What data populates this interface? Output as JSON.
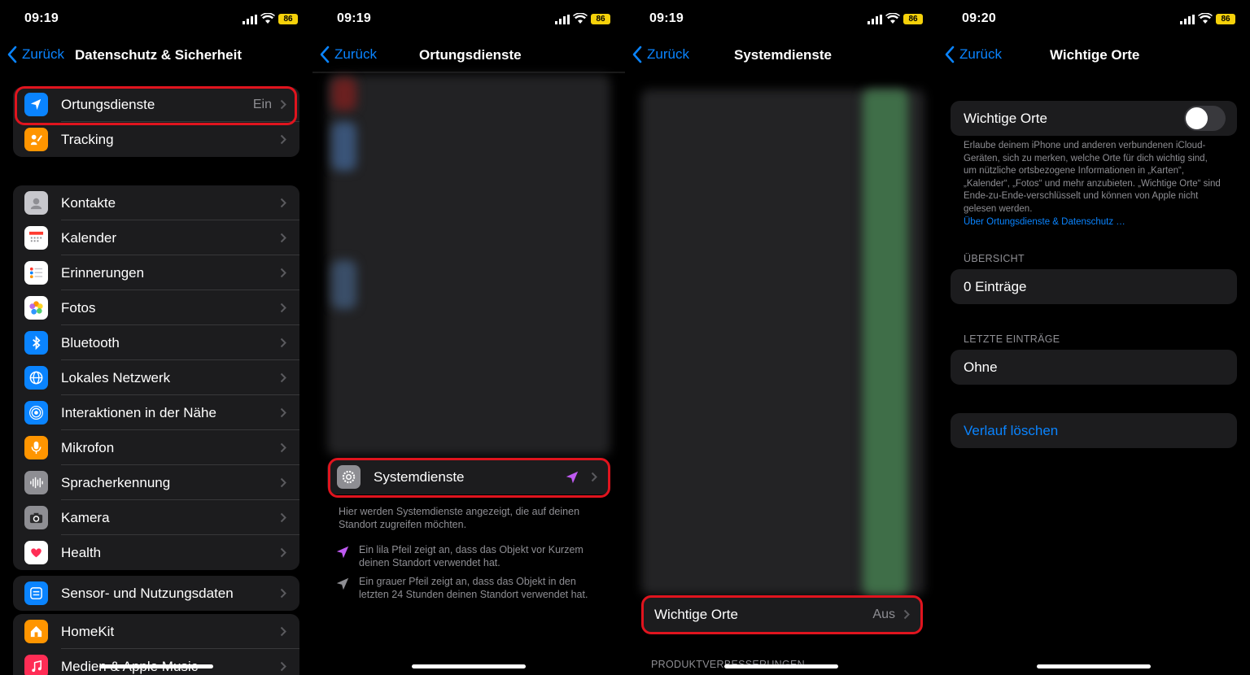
{
  "status": [
    {
      "time": "09:19",
      "battery": "86"
    },
    {
      "time": "09:19",
      "battery": "86"
    },
    {
      "time": "09:19",
      "battery": "86"
    },
    {
      "time": "09:20",
      "battery": "86"
    }
  ],
  "back_label": "Zurück",
  "screen1": {
    "title": "Datenschutz & Sicherheit",
    "group1": [
      {
        "label": "Ortungsdienste",
        "value": "Ein",
        "icon": "location-arrow-icon",
        "color": "#0a84ff"
      },
      {
        "label": "Tracking",
        "value": "",
        "icon": "tracking-icon",
        "color": "#ff9500"
      }
    ],
    "group2": [
      {
        "label": "Kontakte",
        "icon": "contacts-icon",
        "color": "#c7c7cc"
      },
      {
        "label": "Kalender",
        "icon": "calendar-icon",
        "color": "#ffffff"
      },
      {
        "label": "Erinnerungen",
        "icon": "reminders-icon",
        "color": "#ffffff"
      },
      {
        "label": "Fotos",
        "icon": "photos-icon",
        "color": "#ffffff"
      },
      {
        "label": "Bluetooth",
        "icon": "bluetooth-icon",
        "color": "#0a84ff"
      },
      {
        "label": "Lokales Netzwerk",
        "icon": "globe-icon",
        "color": "#0a84ff"
      },
      {
        "label": "Interaktionen in der Nähe",
        "icon": "nearby-icon",
        "color": "#0a84ff"
      },
      {
        "label": "Mikrofon",
        "icon": "microphone-icon",
        "color": "#ff9500"
      },
      {
        "label": "Spracherkennung",
        "icon": "waveform-icon",
        "color": "#8e8e93"
      },
      {
        "label": "Kamera",
        "icon": "camera-icon",
        "color": "#8e8e93"
      },
      {
        "label": "Health",
        "icon": "heart-icon",
        "color": "#ffffff"
      }
    ],
    "group3": [
      {
        "label": "Sensor- und Nutzungsdaten",
        "icon": "sensor-icon",
        "color": "#0a84ff"
      }
    ],
    "group4": [
      {
        "label": "HomeKit",
        "icon": "home-icon",
        "color": "#ff9500"
      },
      {
        "label": "Medien & Apple Music",
        "icon": "music-icon",
        "color": "#ff2d55"
      }
    ]
  },
  "screen2": {
    "title": "Ortungsdienste",
    "system_row": "Systemdienste",
    "description": "Hier werden Systemdienste angezeigt, die auf deinen Standort zugreifen möchten.",
    "legend_purple": "Ein lila Pfeil zeigt an, dass das Objekt vor Kurzem deinen Standort verwendet hat.",
    "legend_gray": "Ein grauer Pfeil zeigt an, dass das Objekt in den letzten 24 Stunden deinen Standort verwendet hat."
  },
  "screen3": {
    "title": "Systemdienste",
    "row_label": "Wichtige Orte",
    "row_value": "Aus",
    "footer_section": "PRODUKTVERBESSERUNGEN"
  },
  "screen4": {
    "title": "Wichtige Orte",
    "toggle_label": "Wichtige Orte",
    "toggle_on": false,
    "description": "Erlaube deinem iPhone und anderen verbundenen iCloud-Geräten, sich zu merken, welche Orte für dich wichtig sind, um nützliche ortsbezogene Informationen in „Karten“, „Kalender“, „Fotos“ und mehr anzubieten. „Wichtige Orte“ sind Ende-zu-Ende-verschlüsselt und können von Apple nicht gelesen werden.",
    "link": "Über Ortungsdienste & Datenschutz …",
    "section_overview": "ÜBERSICHT",
    "overview_value": "0 Einträge",
    "section_recent": "LETZTE EINTRÄGE",
    "recent_value": "Ohne",
    "clear_history": "Verlauf löschen"
  },
  "colors": {
    "accent": "#0a84ff",
    "highlight": "#e0141e",
    "cell": "#1c1c1e",
    "purple_arrow": "#bf5af2"
  }
}
